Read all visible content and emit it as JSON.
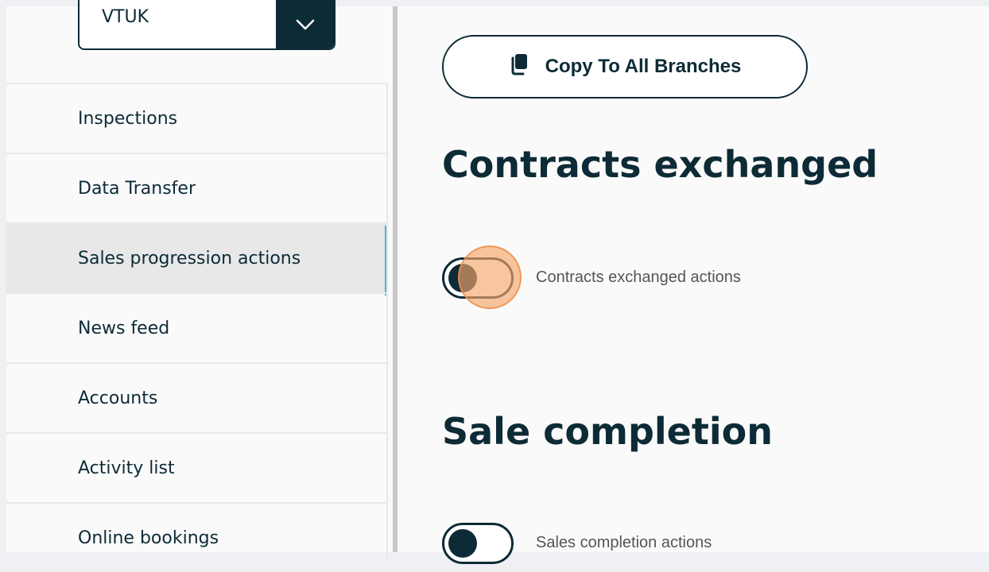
{
  "branch_select": {
    "value": "VTUK"
  },
  "nav": {
    "items": [
      {
        "label": "Inspections"
      },
      {
        "label": "Data Transfer"
      },
      {
        "label": "Sales progression actions"
      },
      {
        "label": "News feed"
      },
      {
        "label": "Accounts"
      },
      {
        "label": "Activity list"
      },
      {
        "label": "Online bookings"
      }
    ],
    "active_index": 2
  },
  "main": {
    "copy_button_label": "Copy To All Branches",
    "sections": [
      {
        "title": "Contracts exchanged",
        "toggle_label": "Contracts exchanged actions",
        "toggle_on": false
      },
      {
        "title": "Sale completion",
        "toggle_label": "Sales completion actions",
        "toggle_on": false
      }
    ]
  },
  "colors": {
    "primary": "#0d2b36",
    "active_indicator": "#47b6d6",
    "highlight": "#f6a66b"
  }
}
